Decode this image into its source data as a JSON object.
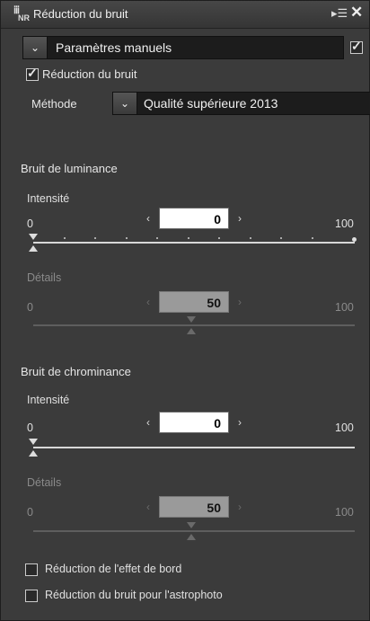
{
  "panel": {
    "title": "Réduction du bruit",
    "icon_text": "NR",
    "preset": {
      "value": "Paramètres manuels",
      "checked": true
    },
    "noise_reduction": {
      "label": "Réduction du bruit",
      "checked": true
    },
    "method": {
      "label": "Méthode",
      "value": "Qualité supérieure 2013"
    },
    "luminance": {
      "title": "Bruit de luminance",
      "intensity": {
        "label": "Intensité",
        "value": "0",
        "min": "0",
        "max": "100"
      },
      "details": {
        "label": "Détails",
        "value": "50",
        "min": "0",
        "max": "100"
      }
    },
    "chrominance": {
      "title": "Bruit de chrominance",
      "intensity": {
        "label": "Intensité",
        "value": "0",
        "min": "0",
        "max": "100"
      },
      "details": {
        "label": "Détails",
        "value": "50",
        "min": "0",
        "max": "100"
      }
    },
    "options": [
      {
        "label": "Réduction de l'effet de bord",
        "checked": false
      },
      {
        "label": "Réduction du bruit pour l'astrophoto",
        "checked": false
      }
    ]
  }
}
